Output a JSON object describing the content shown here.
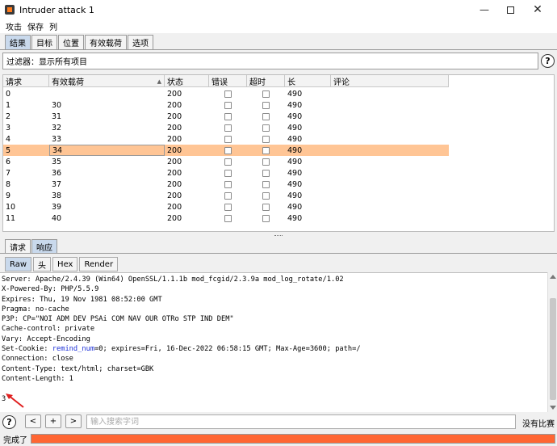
{
  "window": {
    "title": "Intruder attack 1"
  },
  "menu": [
    "攻击",
    "保存",
    "列"
  ],
  "top_tabs": [
    "结果",
    "目标",
    "位置",
    "有效载荷",
    "选项"
  ],
  "filter": {
    "text": "过滤器：显示所有项目"
  },
  "help_label": "?",
  "table": {
    "columns": [
      "请求",
      "有效载荷",
      "状态",
      "错误",
      "超时",
      "长",
      "评论"
    ],
    "sorted_column": "有效载荷",
    "selected_row": 5,
    "rows": [
      {
        "req": "0",
        "payload": "",
        "status": "200",
        "error": false,
        "timeout": false,
        "length": "490",
        "comment": ""
      },
      {
        "req": "1",
        "payload": "30",
        "status": "200",
        "error": false,
        "timeout": false,
        "length": "490",
        "comment": ""
      },
      {
        "req": "2",
        "payload": "31",
        "status": "200",
        "error": false,
        "timeout": false,
        "length": "490",
        "comment": ""
      },
      {
        "req": "3",
        "payload": "32",
        "status": "200",
        "error": false,
        "timeout": false,
        "length": "490",
        "comment": ""
      },
      {
        "req": "4",
        "payload": "33",
        "status": "200",
        "error": false,
        "timeout": false,
        "length": "490",
        "comment": ""
      },
      {
        "req": "5",
        "payload": "34",
        "status": "200",
        "error": false,
        "timeout": false,
        "length": "490",
        "comment": ""
      },
      {
        "req": "6",
        "payload": "35",
        "status": "200",
        "error": false,
        "timeout": false,
        "length": "490",
        "comment": ""
      },
      {
        "req": "7",
        "payload": "36",
        "status": "200",
        "error": false,
        "timeout": false,
        "length": "490",
        "comment": ""
      },
      {
        "req": "8",
        "payload": "37",
        "status": "200",
        "error": false,
        "timeout": false,
        "length": "490",
        "comment": ""
      },
      {
        "req": "9",
        "payload": "38",
        "status": "200",
        "error": false,
        "timeout": false,
        "length": "490",
        "comment": ""
      },
      {
        "req": "10",
        "payload": "39",
        "status": "200",
        "error": false,
        "timeout": false,
        "length": "490",
        "comment": ""
      },
      {
        "req": "11",
        "payload": "40",
        "status": "200",
        "error": false,
        "timeout": false,
        "length": "490",
        "comment": ""
      }
    ]
  },
  "detail_tabs": [
    "请求",
    "响应"
  ],
  "detail_active": "响应",
  "view_tabs": [
    "Raw",
    "头",
    "Hex",
    "Render"
  ],
  "view_active": "Raw",
  "response_lines": [
    "Server: Apache/2.4.39 (Win64) OpenSSL/1.1.1b mod_fcgid/2.3.9a mod_log_rotate/1.02",
    "X-Powered-By: PHP/5.5.9",
    "Expires: Thu, 19 Nov 1981 08:52:00 GMT",
    "Pragma: no-cache",
    "P3P: CP=\"NOI ADM DEV PSAi COM NAV OUR OTRo STP IND DEM\"",
    "Cache-control: private",
    "Vary: Accept-Encoding",
    "SETCOOKIE",
    "Connection: close",
    "Content-Type: text/html; charset=GBK",
    "Content-Length: 1",
    "",
    "3"
  ],
  "cookie_line": {
    "prefix": "Set-Cookie: ",
    "name": "remind_num",
    "rest": "=0; expires=Fri, 16-Dec-2022 06:58:15 GMT; Max-Age=3600; path=/"
  },
  "search": {
    "prev_label": "<",
    "add_label": "+",
    "next_label": ">",
    "placeholder": "输入搜索字词",
    "result": "没有比赛"
  },
  "status": {
    "text": "完成了",
    "progress": 1.0
  },
  "colors": {
    "selected_row": "#ffc595",
    "progress": "#ff6633",
    "cookie_name": "#1b2fd6"
  }
}
